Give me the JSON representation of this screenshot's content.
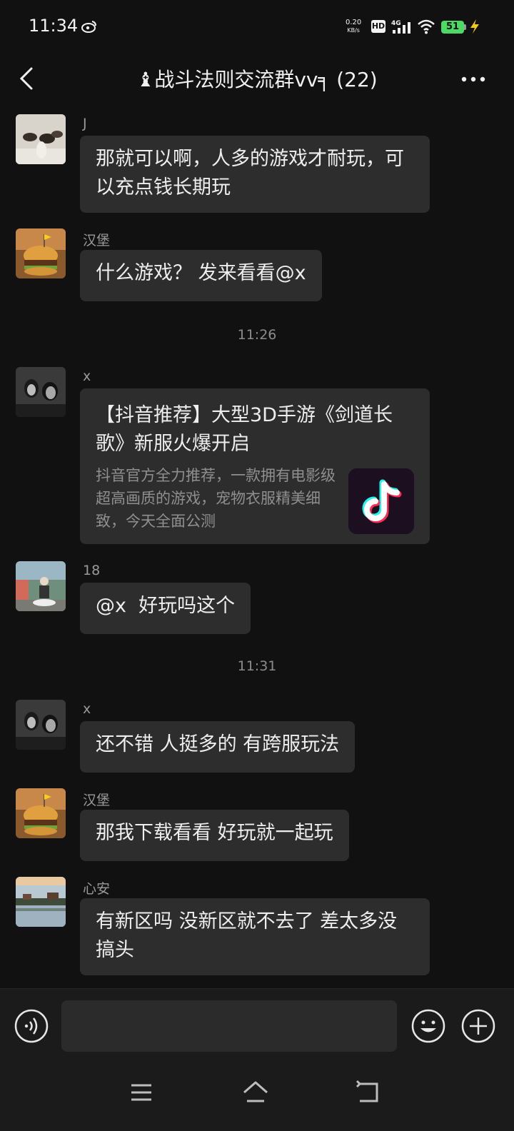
{
  "status_bar": {
    "time": "11:34",
    "net_speed_value": "0.20",
    "net_speed_unit": "KB/s",
    "hd_label": "HD",
    "network": "4G",
    "battery": "51"
  },
  "header": {
    "title": "♝战斗法则交流群vv╕ (22)"
  },
  "messages": [
    {
      "sender": "J",
      "text": "那就可以啊，人多的游戏才耐玩，可以充点钱长期玩"
    },
    {
      "sender": "汉堡",
      "text": "什么游戏？ 发来看看@x"
    },
    {
      "time": "11:26"
    },
    {
      "sender": "x",
      "card": {
        "title": "【抖音推荐】大型3D手游《剑道长歌》新服火爆开启",
        "description": "抖音官方全力推荐，一款拥有电影级超高画质的游戏，宠物衣服精美细致，今天全面公测",
        "thumb_icon": "tiktok-logo-icon"
      }
    },
    {
      "sender": "18",
      "text": "@x  好玩吗这个"
    },
    {
      "time": "11:31"
    },
    {
      "sender": "x",
      "text": "还不错 人挺多的 有跨服玩法"
    },
    {
      "sender": "汉堡",
      "text": "那我下载看看 好玩就一起玩"
    },
    {
      "sender": "心安",
      "text": "有新区吗 没新区就不去了 差太多没搞头"
    }
  ],
  "input_bar": {
    "placeholder": "",
    "value": ""
  },
  "colors": {
    "background": "#111111",
    "bubble": "#2d2d2d",
    "battery": "#4cd964"
  }
}
